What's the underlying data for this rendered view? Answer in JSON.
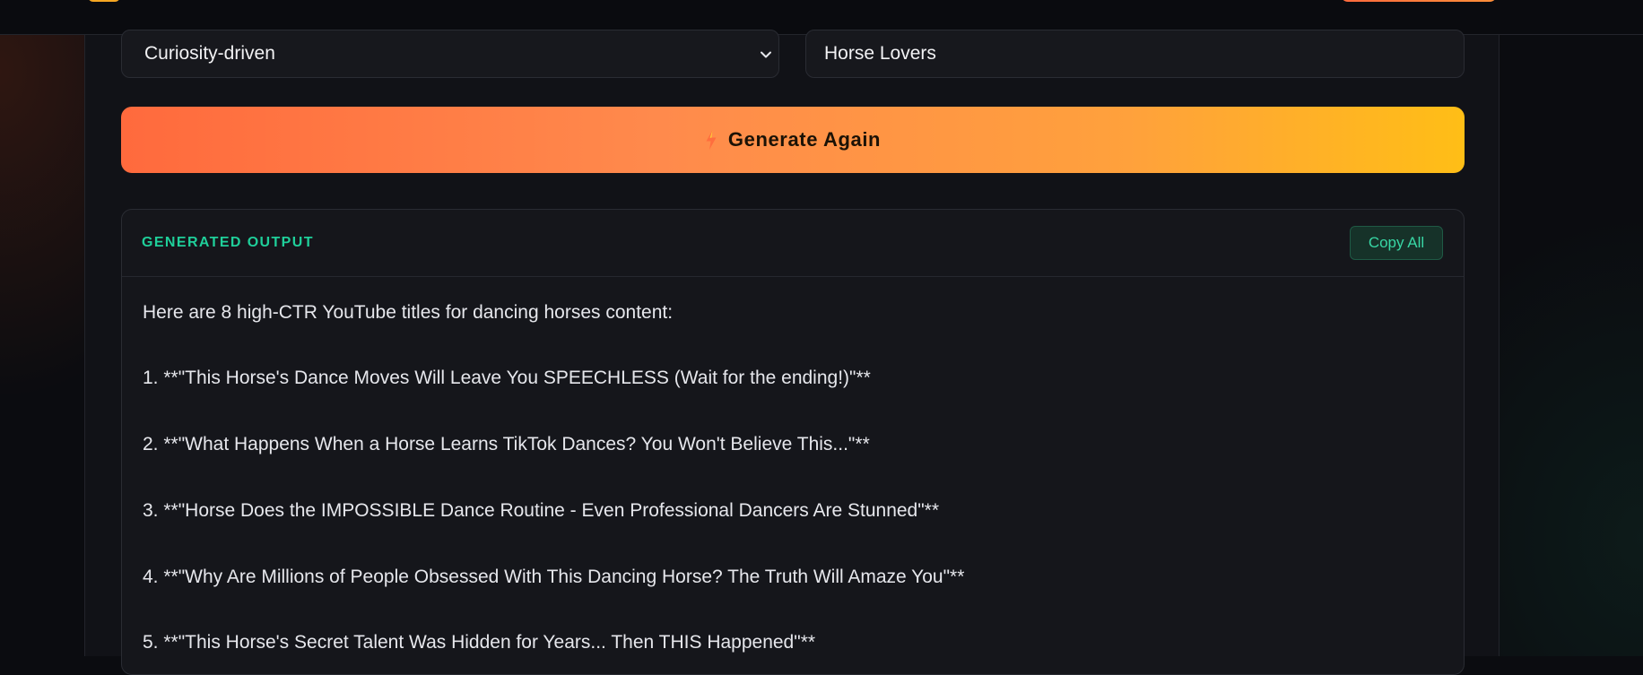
{
  "form": {
    "tone_select_value": "Curiosity-driven",
    "audience_input_value": "Horse Lovers"
  },
  "actions": {
    "generate_again_label": "Generate Again"
  },
  "output": {
    "title": "GENERATED OUTPUT",
    "copy_all_label": "Copy All",
    "intro": "Here are 8 high-CTR YouTube titles for dancing horses content:",
    "items": [
      "1. **\"This Horse's Dance Moves Will Leave You SPEECHLESS (Wait for the ending!)\"**",
      "2. **\"What Happens When a Horse Learns TikTok Dances? You Won't Believe This...\"**",
      "3. **\"Horse Does the IMPOSSIBLE Dance Routine - Even Professional Dancers Are Stunned\"**",
      "4. **\"Why Are Millions of People Obsessed With This Dancing Horse? The Truth Will Amaze You\"**",
      "5. **\"This Horse's Secret Talent Was Hidden for Years... Then THIS Happened\"**"
    ]
  },
  "colors": {
    "accent_green": "#1fcf9a",
    "gradient_start": "#ff6a3d",
    "gradient_end": "#ffbe16",
    "background": "#0b0c10"
  },
  "icons": {
    "chevron": "chevron-down-icon",
    "bolt": "lightning-icon"
  }
}
